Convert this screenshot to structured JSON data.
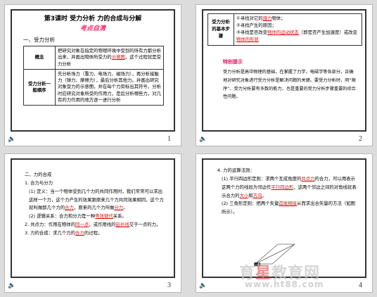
{
  "slide1": {
    "title": "第3课时  受力分析  力的合成与分解",
    "subtitle": "考点自清",
    "section": "一、受力分析",
    "rows": [
      {
        "head": "概念",
        "parts": [
          {
            "t": "把研究对象在指定的物理环境中受到的所有力都分析出来，并画出物体所受力的",
            "c": ""
          },
          {
            "t": "示意图",
            "c": "u-red"
          },
          {
            "t": "，这个过程就是受力分析",
            "c": ""
          }
        ]
      },
      {
        "head": "受力分析一般顺序",
        "parts": [
          {
            "t": "先分析场力（重力、电场力、磁场力），再分析接触力（弹力、摩擦力），最后分析其他力。并画出研究对象受力的示意图，并在每个力旁标出其符号，分析时应研究对象所受的作用力，是后分析哪些力，对几有的力作用的地方逐一进行分析",
            "c": ""
          }
        ]
      }
    ],
    "page": "1"
  },
  "slide2": {
    "head": "受力分析的基本步骤",
    "items": [
      [
        {
          "t": "①寻找对它的",
          "c": ""
        },
        {
          "t": "施力",
          "c": "u-red"
        },
        {
          "t": "物体；",
          "c": ""
        }
      ],
      [
        {
          "t": "②寻找产生的原因；",
          "c": ""
        }
      ],
      [
        {
          "t": "③寻找是否改变",
          "c": ""
        },
        {
          "t": "物体的运动状态",
          "c": "u-red"
        },
        {
          "t": "（即是否产生加速度）或改变",
          "c": ""
        },
        {
          "t": "物体的形状",
          "c": "u-red"
        }
      ]
    ],
    "tip": "特别提示",
    "para": "受力分析是高中物理的基础，在掌握了力学、电磁学等各部分，正确地对研究对象进行受力分析是解决问题的关键。要受力分析时，同“顺序”、受力分析要有多数的能力，也是重要的受力分析步骤重要的综合性问题。",
    "page": "2"
  },
  "slide3": {
    "lines": [
      {
        "cls": "",
        "parts": [
          {
            "t": "二、力的合成",
            "c": ""
          }
        ]
      },
      {
        "cls": "",
        "parts": [
          {
            "t": "1. 合力与分力",
            "c": ""
          }
        ]
      },
      {
        "cls": "ind",
        "parts": [
          {
            "t": "(1) 定义：当一个物体受到几个力的共同作用时，我们常常可以求出这样一个力，这个力产生的效果跟原来几个力共同效果相同，这个力就叫做那几个力的",
            "c": ""
          },
          {
            "t": "合力",
            "c": "u-red"
          },
          {
            "t": "，原来的几个力叫做",
            "c": ""
          },
          {
            "t": "分力",
            "c": "u-red"
          },
          {
            "t": "。",
            "c": ""
          }
        ]
      },
      {
        "cls": "ind",
        "parts": [
          {
            "t": "(2) 逻辑关系：合力和分力是一种",
            "c": ""
          },
          {
            "t": "等效替代",
            "c": "u-red"
          },
          {
            "t": "关系。",
            "c": ""
          }
        ]
      },
      {
        "cls": "",
        "parts": [
          {
            "t": "2. 共点力：作用在物体的",
            "c": ""
          },
          {
            "t": "同一点",
            "c": "u-red"
          },
          {
            "t": "，或作用线的",
            "c": ""
          },
          {
            "t": "延长线",
            "c": "u-red"
          },
          {
            "t": "交于一点的力。",
            "c": ""
          }
        ]
      },
      {
        "cls": "",
        "parts": [
          {
            "t": "3. 力的合成：求几个力的",
            "c": ""
          },
          {
            "t": "合力",
            "c": "u-red"
          },
          {
            "t": "的过程。",
            "c": ""
          }
        ]
      }
    ],
    "page": "3"
  },
  "slide4": {
    "lines": [
      {
        "cls": "",
        "parts": [
          {
            "t": "4. 力的运算法则：",
            "c": ""
          }
        ]
      },
      {
        "cls": "ind",
        "parts": [
          {
            "t": "(1) 平行四边形定则：求两个互成角度的",
            "c": ""
          },
          {
            "t": "共点力",
            "c": "u-red"
          },
          {
            "t": "的合力，可以用表示这两个力的线段为邻边作",
            "c": ""
          },
          {
            "t": "平行四边形",
            "c": "u-red"
          },
          {
            "t": "，这两个邻边之间的对角线就表示合力的",
            "c": ""
          },
          {
            "t": "大小",
            "c": "u-red"
          },
          {
            "t": "和",
            "c": ""
          },
          {
            "t": "方向",
            "c": "u-red"
          },
          {
            "t": "。",
            "c": ""
          }
        ]
      },
      {
        "cls": "ind",
        "parts": [
          {
            "t": "(2) 三角形定则：把两个矢量",
            "c": ""
          },
          {
            "t": "首尾相接",
            "c": "u-red"
          },
          {
            "t": "从而求出合矢量的方法（如图所示）。",
            "c": ""
          }
        ]
      }
    ],
    "fig": "图1",
    "page": "4"
  },
  "watermark": {
    "left": "育",
    "star": "星",
    "right": "教育网",
    "url": "www.ht88.com"
  },
  "icons": {
    "footer_icon": "speaker-icon"
  },
  "colors": {
    "accent_red": "#e01010",
    "subtitle": "#ff2a6a"
  }
}
